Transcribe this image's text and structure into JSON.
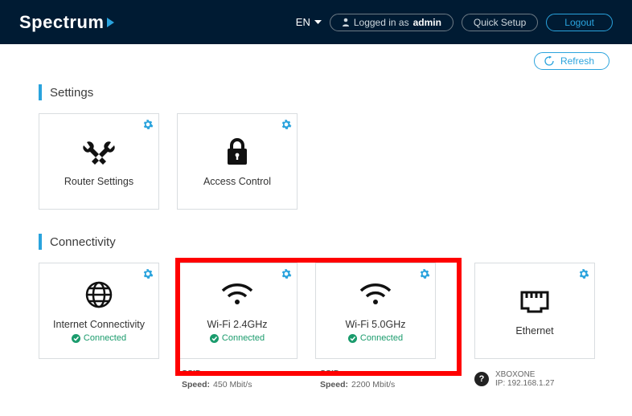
{
  "header": {
    "logo": "Spectrum",
    "lang": "EN",
    "logged_prefix": "Logged in as ",
    "logged_user": "admin",
    "quick_setup": "Quick Setup",
    "logout": "Logout"
  },
  "toolbar": {
    "refresh": "Refresh"
  },
  "sections": {
    "settings": {
      "title": "Settings",
      "cards": [
        {
          "label": "Router Settings"
        },
        {
          "label": "Access Control"
        }
      ]
    },
    "connectivity": {
      "title": "Connectivity",
      "cards": [
        {
          "label": "Internet Connectivity",
          "status": "Connected"
        },
        {
          "label": "Wi-Fi 2.4GHz",
          "status": "Connected"
        },
        {
          "label": "Wi-Fi 5.0GHz",
          "status": "Connected"
        },
        {
          "label": "Ethernet"
        }
      ],
      "details": {
        "wifi24": {
          "ssid_label": "SSID:",
          "ssid": "",
          "speed_label": "Speed:",
          "speed": "450 Mbit/s"
        },
        "wifi50": {
          "ssid_label": "SSID:",
          "ssid": "",
          "speed_label": "Speed:",
          "speed": "2200 Mbit/s"
        },
        "eth": {
          "name": "XBOXONE",
          "ip_label": "IP:",
          "ip": "192.168.1.27"
        }
      }
    }
  }
}
